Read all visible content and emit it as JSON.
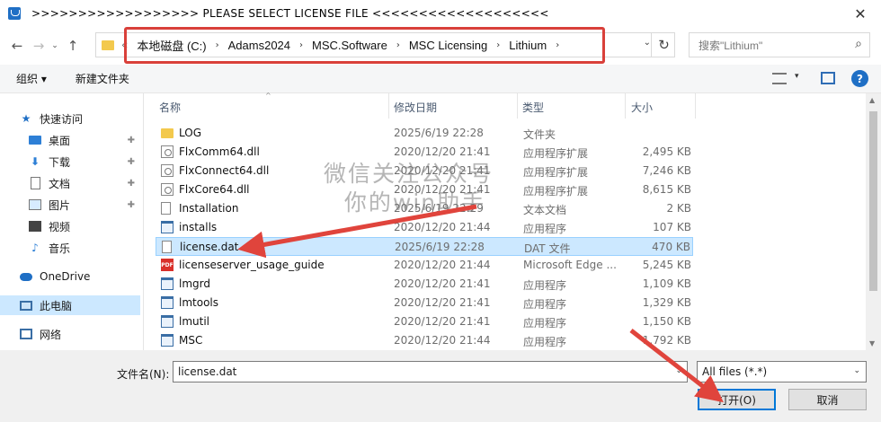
{
  "window": {
    "title": ">>>>>>>>>>>>>>>>>>  PLEASE SELECT LICENSE FILE  <<<<<<<<<<<<<<<<<<<",
    "close_glyph": "✕"
  },
  "nav": {
    "back": "←",
    "forward": "→",
    "recent": "⌄",
    "up": "↑"
  },
  "address": {
    "more": "«",
    "crumbs": [
      "本地磁盘 (C:)",
      "Adams2024",
      "MSC.Software",
      "MSC Licensing",
      "Lithium"
    ],
    "sep": "›",
    "dropdown": "⌄",
    "refresh": "↻",
    "highlight_color": "#d9403a"
  },
  "search": {
    "placeholder": "搜索\"Lithium\"",
    "icon": "⌕"
  },
  "toolbar": {
    "organize": "组织 ▾",
    "new_folder": "新建文件夹",
    "view_dropdown": "▾",
    "help": "?"
  },
  "sidebar": {
    "items": [
      {
        "label": "快速访问",
        "icon": "star-icon"
      },
      {
        "label": "桌面",
        "icon": "desktop-icon",
        "pinned": true
      },
      {
        "label": "下载",
        "icon": "download-icon",
        "pinned": true
      },
      {
        "label": "文档",
        "icon": "document-icon",
        "pinned": true
      },
      {
        "label": "图片",
        "icon": "pictures-icon",
        "pinned": true
      },
      {
        "label": "视频",
        "icon": "video-icon"
      },
      {
        "label": "音乐",
        "icon": "music-icon"
      },
      {
        "label": "OneDrive",
        "icon": "cloud-icon"
      },
      {
        "label": "此电脑",
        "icon": "computer-icon",
        "selected": true
      },
      {
        "label": "网络",
        "icon": "network-icon"
      }
    ],
    "pin_glyph": "📌"
  },
  "columns": {
    "name": "名称",
    "date": "修改日期",
    "type": "类型",
    "size": "大小",
    "sort_glyph": "^"
  },
  "files": [
    {
      "name": "LOG",
      "date": "2025/6/19 22:28",
      "type": "文件夹",
      "size": "",
      "icon": "folder-icon"
    },
    {
      "name": "FlxComm64.dll",
      "date": "2020/12/20 21:41",
      "type": "应用程序扩展",
      "size": "2,495 KB",
      "icon": "dll-icon"
    },
    {
      "name": "FlxConnect64.dll",
      "date": "2020/12/20 21:41",
      "type": "应用程序扩展",
      "size": "7,246 KB",
      "icon": "dll-icon"
    },
    {
      "name": "FlxCore64.dll",
      "date": "2020/12/20 21:41",
      "type": "应用程序扩展",
      "size": "8,615 KB",
      "icon": "dll-icon"
    },
    {
      "name": "Installation",
      "date": "2025/6/19 22:29",
      "type": "文本文档",
      "size": "2 KB",
      "icon": "text-file-icon"
    },
    {
      "name": "installs",
      "date": "2020/12/20 21:44",
      "type": "应用程序",
      "size": "107 KB",
      "icon": "exe-icon"
    },
    {
      "name": "license.dat",
      "date": "2025/6/19 22:28",
      "type": "DAT 文件",
      "size": "470 KB",
      "icon": "text-file-icon",
      "selected": true
    },
    {
      "name": "licenseserver_usage_guide",
      "date": "2020/12/20 21:44",
      "type": "Microsoft Edge ...",
      "size": "5,245 KB",
      "icon": "pdf-icon"
    },
    {
      "name": "lmgrd",
      "date": "2020/12/20 21:41",
      "type": "应用程序",
      "size": "1,109 KB",
      "icon": "exe-icon"
    },
    {
      "name": "lmtools",
      "date": "2020/12/20 21:41",
      "type": "应用程序",
      "size": "1,329 KB",
      "icon": "exe-icon"
    },
    {
      "name": "lmutil",
      "date": "2020/12/20 21:41",
      "type": "应用程序",
      "size": "1,150 KB",
      "icon": "exe-icon"
    },
    {
      "name": "MSC",
      "date": "2020/12/20 21:44",
      "type": "应用程序",
      "size": "1,792 KB",
      "icon": "exe-icon"
    }
  ],
  "bottom": {
    "filename_label": "文件名(N):",
    "filename_value": "license.dat",
    "filetype_value": "All files (*.*)",
    "open_label": "打开(O)",
    "cancel_label": "取消",
    "drop": "⌄"
  },
  "watermark": {
    "line1": "微信关注公众号",
    "line2": "你的win助手"
  },
  "annotation_color": "#e0443c"
}
